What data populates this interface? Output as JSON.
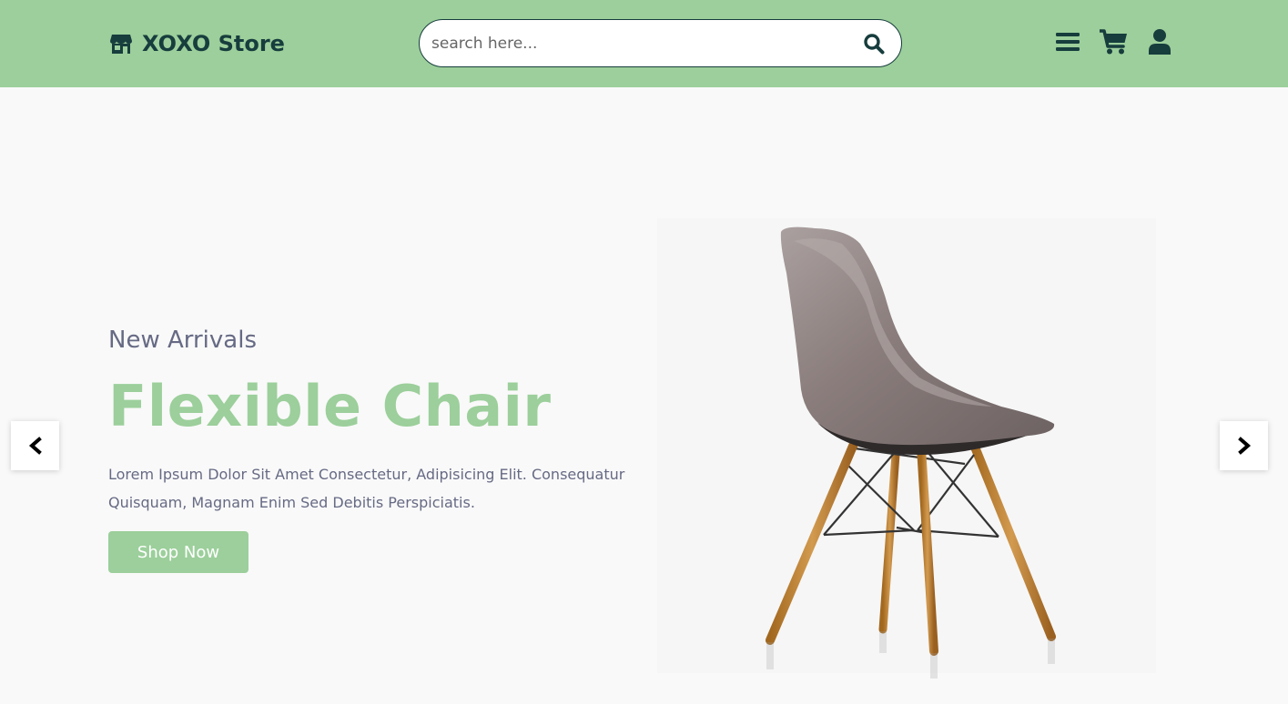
{
  "header": {
    "logo_text": "XOXO Store",
    "logo_icon": "store-icon",
    "search_placeholder": "search here...",
    "search_value": "",
    "icons": [
      "menu-icon",
      "cart-icon",
      "user-icon"
    ]
  },
  "hero": {
    "eyebrow": "New Arrivals",
    "title": "Flexible Chair",
    "description": "Lorem Ipsum Dolor Sit Amet Consectetur, Adipisicing Elit. Consequatur Quisquam, Magnam Enim Sed Debitis Perspiciatis.",
    "cta_label": "Shop Now",
    "image": "chair-image"
  },
  "carousel": {
    "prev_icon": "chevron-left-icon",
    "next_icon": "chevron-right-icon"
  },
  "colors": {
    "brand": "#9ccf9b",
    "dark": "#173d3d",
    "text_muted": "#666a84",
    "background": "#f9f9f9"
  }
}
